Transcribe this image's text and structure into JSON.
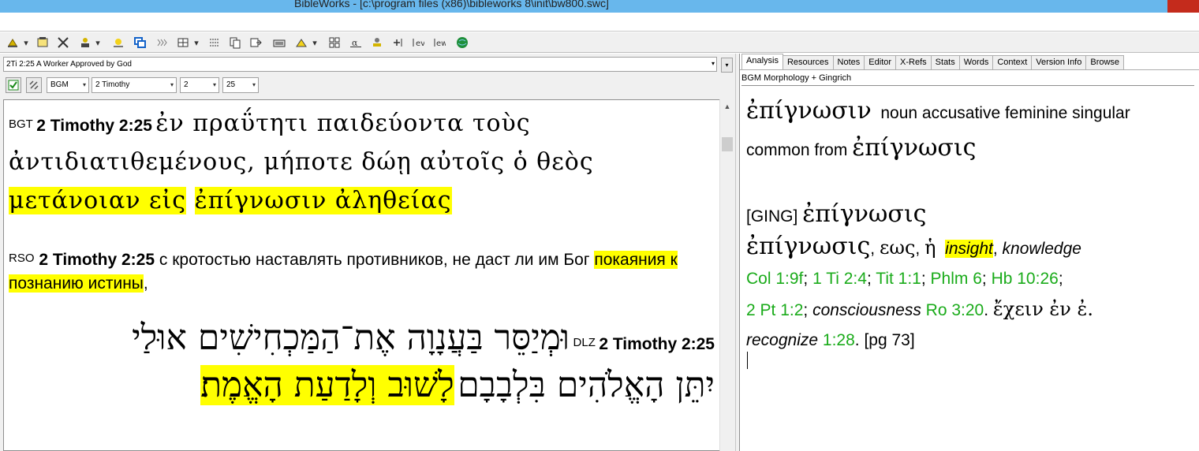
{
  "window": {
    "title": "BibleWorks - [c:\\program files (x86)\\bibleworks 8\\init\\bw800.swc]"
  },
  "colors": {
    "titlebar": "#68b7ec",
    "highlight": "#ffff00",
    "link": "#1aab1a"
  },
  "toolbar": {
    "icons": [
      "search-icon",
      "dropdown-icon",
      "tools-icon",
      "settings-icon",
      "user-icon",
      "dropdown-icon",
      "lamp-icon",
      "window-icon",
      "columns-icon",
      "grid-icon",
      "dropdown-icon",
      "list-icon",
      "copy-icon",
      "export-icon",
      "keyboard-icon",
      "map-icon",
      "dropdown-icon",
      "layout-icon",
      "alpha-icon",
      "person-icon",
      "add-icon",
      "ev-icon",
      "ew-icon",
      "globe-icon"
    ]
  },
  "left": {
    "verse_title": "2Ti 2:25 A Worker Approved by God",
    "version_combo": "BGM",
    "book_combo": "2 Timothy",
    "chapter_combo": "2",
    "verse_combo": "25",
    "bgt": {
      "label": "BGT",
      "ref": "2 Timothy 2:25",
      "text_plain": "ἐν πραΰτητι παιδεύοντα τοὺς ἀντιδιατιθεμένους, μήποτε δώῃ αὐτοῖς ὁ θεὸς",
      "hl1": "μετάνοιαν εἰς",
      "space": " ",
      "hl2": "ἐπίγνωσιν ἀληθείας"
    },
    "rso": {
      "label": "RSO",
      "ref": "2 Timothy 2:25",
      "text_plain": "с кротостью наставлять противников, не даст ли им Бог",
      "hl": "покаяния к познанию истины",
      "tail": ","
    },
    "dlz": {
      "label": "DLZ",
      "ref": "2 Timothy 2:25",
      "line1": "וּמְיַסֵּר בַּעֲנָוָה אֶת־הַמַּכְחִישִׁים אוּלַי",
      "line2_plain": "יִתֵּן הָאֱלֹהִים בִּלְבָבָם",
      "line2_hl": "לָשׁוּב וְלָדַעַת הָאֱמֶת׃"
    }
  },
  "right": {
    "tabs": [
      "Analysis",
      "Resources",
      "Notes",
      "Editor",
      "X-Refs",
      "Stats",
      "Words",
      "Context",
      "Version Info",
      "Browse"
    ],
    "caption": "BGM Morphology + Gingrich",
    "analysis": {
      "word": "ἐπίγνωσιν",
      "parse": "noun accusative feminine singular common from",
      "lemma": "ἐπίγνωσις",
      "ging_tag": "[GING]",
      "ging_lemma": "ἐπίγνωσις",
      "entry_head": "ἐπίγνωσις",
      "entry_sep1": ",",
      "entry_gen": "εως",
      "entry_sep2": ",",
      "entry_art": "ἡ",
      "gloss_hl": "insight",
      "gloss_sep": ",",
      "gloss2": "knowledge",
      "refs1": [
        "Col 1:9f",
        "1 Ti 2:4",
        "Tit 1:1",
        "Phlm 6",
        "Hb 10:26"
      ],
      "ref_sep": ";",
      "refs2": "2 Pt 1:2",
      "semi": ";",
      "gloss3": "consciousness",
      "ref3": "Ro 3:20",
      "dot": ".",
      "greek_phrase": "ἔχειν ἐν ἐ.",
      "gloss4": "recognize",
      "ref4": "1:28",
      "page": ". [pg 73]"
    }
  }
}
